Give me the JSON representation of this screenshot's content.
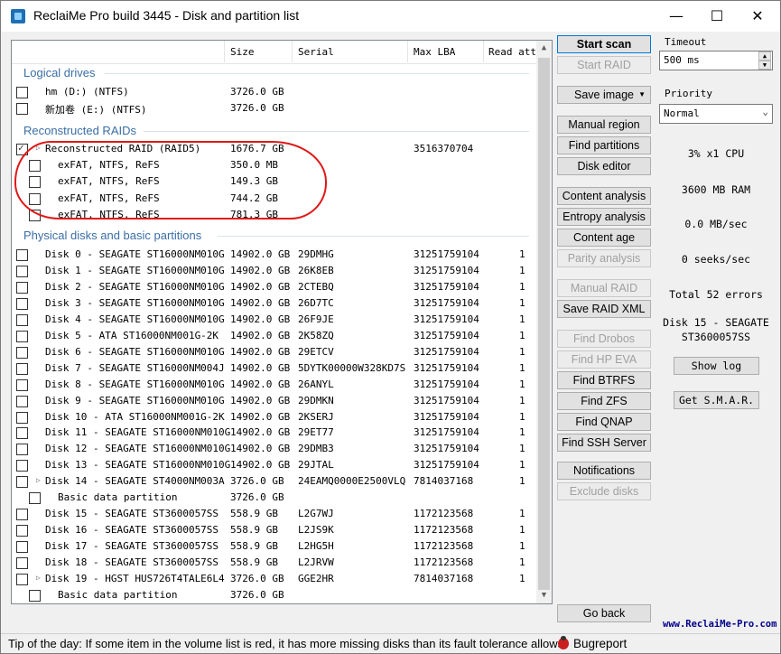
{
  "window": {
    "title": "ReclaiMe Pro build 3445 - Disk and partition list",
    "minimize": "—",
    "maximize": "☐",
    "close": "✕"
  },
  "columns": [
    "Size",
    "Serial",
    "Max LBA",
    "Read att"
  ],
  "groups": {
    "logical": "Logical drives",
    "raids": "Reconstructed RAIDs",
    "physical": "Physical disks and basic partitions"
  },
  "logical_drives": [
    {
      "name": "hm (D:) (NTFS)",
      "size": "3726.0 GB"
    },
    {
      "name": "新加卷 (E:) (NTFS)",
      "size": "3726.0 GB"
    }
  ],
  "raids": [
    {
      "name": "Reconstructed RAID (RAID5)",
      "size": "1676.7 GB",
      "serial": "",
      "lba": "3516370704",
      "checked": true
    },
    {
      "name": "exFAT, NTFS, ReFS",
      "size": "350.0 MB"
    },
    {
      "name": "exFAT, NTFS, ReFS",
      "size": "149.3 GB"
    },
    {
      "name": "exFAT, NTFS, ReFS",
      "size": "744.2 GB"
    },
    {
      "name": "exFAT, NTFS, ReFS",
      "size": "781.3 GB"
    }
  ],
  "disks": [
    {
      "name": "Disk 0 - SEAGATE ST16000NM010G",
      "size": "14902.0 GB",
      "serial": "29DMHG",
      "lba": "31251759104",
      "read": "1"
    },
    {
      "name": "Disk 1 - SEAGATE ST16000NM010G",
      "size": "14902.0 GB",
      "serial": "26K8EB",
      "lba": "31251759104",
      "read": "1"
    },
    {
      "name": "Disk 2 - SEAGATE ST16000NM010G",
      "size": "14902.0 GB",
      "serial": "2CTEBQ",
      "lba": "31251759104",
      "read": "1"
    },
    {
      "name": "Disk 3 - SEAGATE ST16000NM010G",
      "size": "14902.0 GB",
      "serial": "26D7TC",
      "lba": "31251759104",
      "read": "1"
    },
    {
      "name": "Disk 4 - SEAGATE ST16000NM010G",
      "size": "14902.0 GB",
      "serial": "26F9JE",
      "lba": "31251759104",
      "read": "1"
    },
    {
      "name": "Disk 5 - ATA ST16000NM001G-2K",
      "size": "14902.0 GB",
      "serial": "2K58ZQ",
      "lba": "31251759104",
      "read": "1"
    },
    {
      "name": "Disk 6 - SEAGATE ST16000NM010G",
      "size": "14902.0 GB",
      "serial": "29ETCV",
      "lba": "31251759104",
      "read": "1"
    },
    {
      "name": "Disk 7 - SEAGATE ST16000NM004J",
      "size": "14902.0 GB",
      "serial": "5DYTK00000W328KD7S",
      "lba": "31251759104",
      "read": "1"
    },
    {
      "name": "Disk 8 - SEAGATE ST16000NM010G",
      "size": "14902.0 GB",
      "serial": "26ANYL",
      "lba": "31251759104",
      "read": "1"
    },
    {
      "name": "Disk 9 - SEAGATE ST16000NM010G",
      "size": "14902.0 GB",
      "serial": "29DMKN",
      "lba": "31251759104",
      "read": "1"
    },
    {
      "name": "Disk 10 - ATA ST16000NM001G-2K",
      "size": "14902.0 GB",
      "serial": "2KSERJ",
      "lba": "31251759104",
      "read": "1"
    },
    {
      "name": "Disk 11 - SEAGATE ST16000NM010G",
      "size": "14902.0 GB",
      "serial": "29ET77",
      "lba": "31251759104",
      "read": "1"
    },
    {
      "name": "Disk 12 - SEAGATE ST16000NM010G",
      "size": "14902.0 GB",
      "serial": "29DMB3",
      "lba": "31251759104",
      "read": "1"
    },
    {
      "name": "Disk 13 - SEAGATE ST16000NM010G",
      "size": "14902.0 GB",
      "serial": "29JTAL",
      "lba": "31251759104",
      "read": "1"
    },
    {
      "name": "Disk 14 - SEAGATE ST4000NM003A",
      "size": "3726.0 GB",
      "serial": "24EAMQ0000E2500VLQ",
      "lba": "7814037168",
      "read": "1",
      "expand": true
    },
    {
      "name": "Basic data partition",
      "size": "3726.0 GB",
      "serial": "",
      "lba": "",
      "read": "",
      "child": true
    },
    {
      "name": "Disk 15 - SEAGATE ST3600057SS",
      "size": "558.9 GB",
      "serial": "L2G7WJ",
      "lba": "1172123568",
      "read": "1"
    },
    {
      "name": "Disk 16 - SEAGATE ST3600057SS",
      "size": "558.9 GB",
      "serial": "L2JS9K",
      "lba": "1172123568",
      "read": "1"
    },
    {
      "name": "Disk 17 - SEAGATE ST3600057SS",
      "size": "558.9 GB",
      "serial": "L2HG5H",
      "lba": "1172123568",
      "read": "1"
    },
    {
      "name": "Disk 18 - SEAGATE ST3600057SS",
      "size": "558.9 GB",
      "serial": "L2JRVW",
      "lba": "1172123568",
      "read": "1"
    },
    {
      "name": "Disk 19 - HGST HUS726T4TALE6L4",
      "size": "3726.0 GB",
      "serial": "GGE2HR",
      "lba": "7814037168",
      "read": "1",
      "expand": true
    },
    {
      "name": "Basic data partition",
      "size": "3726.0 GB",
      "serial": "",
      "lba": "",
      "read": "",
      "child": true
    }
  ],
  "buttons": {
    "start_scan": "Start scan",
    "start_raid": "Start RAID",
    "save_image": "Save image",
    "manual_region": "Manual region",
    "find_partitions": "Find partitions",
    "disk_editor": "Disk editor",
    "content_analysis": "Content analysis",
    "entropy_analysis": "Entropy analysis",
    "content_age": "Content age",
    "parity_analysis": "Parity analysis",
    "manual_raid": "Manual RAID",
    "save_raid_xml": "Save RAID XML",
    "find_drobos": "Find Drobos",
    "find_hp_eva": "Find HP EVA",
    "find_btrfs": "Find BTRFS",
    "find_zfs": "Find ZFS",
    "find_qnap": "Find QNAP",
    "find_ssh": "Find SSH Server",
    "notifications": "Notifications",
    "exclude_disks": "Exclude disks",
    "go_back": "Go back"
  },
  "side": {
    "timeout_label": "Timeout",
    "timeout_value": "500 ms",
    "priority_label": "Priority",
    "priority_value": "Normal",
    "cpu": "3% x1 CPU",
    "ram": "3600 MB RAM",
    "speed": "0.0 MB/sec",
    "seeks": "0 seeks/sec",
    "errors": "Total 52 errors",
    "current_disk_1": "Disk 15 - SEAGATE",
    "current_disk_2": "ST3600057SS",
    "show_log": "Show log",
    "get_smart": "Get S.M.A.R.",
    "url": "www.ReclaiMe-Pro.com"
  },
  "statusbar": {
    "tip": "Tip of the day: If some item in the volume list is red, it has more missing disks than its fault tolerance allows.",
    "bugreport": "Bugreport"
  }
}
